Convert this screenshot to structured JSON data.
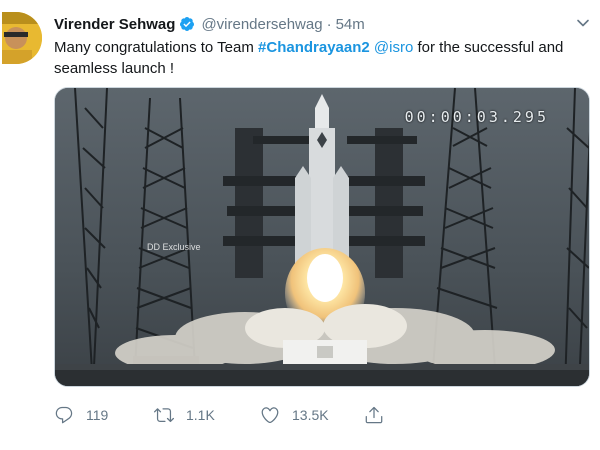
{
  "tweet": {
    "author": {
      "name": "Virender Sehwag",
      "handle": "@virendersehwag",
      "separator": "·",
      "time": "54m",
      "verified": true
    },
    "text": {
      "prefix": "Many congratulations to Team ",
      "hashtag": "#Chandrayaan2",
      "space": " ",
      "mention": "@isro",
      "suffix": " for the successful and seamless launch !"
    },
    "media": {
      "timecode": "00:00:03.295",
      "watermark": "DD Exclusive"
    },
    "actions": {
      "reply_count": "119",
      "retweet_count": "1.1K",
      "like_count": "13.5K"
    }
  },
  "icons": {
    "verified": "verified-badge-icon",
    "caret": "chevron-down-icon",
    "reply": "reply-icon",
    "retweet": "retweet-icon",
    "like": "heart-icon",
    "share": "share-icon"
  },
  "colors": {
    "link": "#1b95e0",
    "secondary_text": "#657786",
    "primary_text": "#14171a"
  }
}
